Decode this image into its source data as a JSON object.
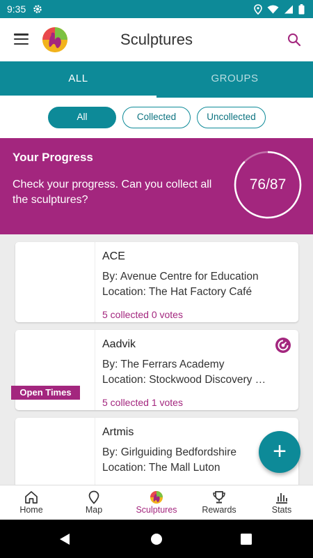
{
  "status_bar": {
    "time": "9:35"
  },
  "app_bar": {
    "title": "Sculptures"
  },
  "tabs": [
    {
      "label": "ALL",
      "active": true
    },
    {
      "label": "GROUPS",
      "active": false
    }
  ],
  "filters": [
    {
      "label": "All",
      "active": true
    },
    {
      "label": "Collected",
      "active": false
    },
    {
      "label": "Uncollected",
      "active": false
    }
  ],
  "progress": {
    "title": "Your Progress",
    "text": "Check your progress. Can you collect all the sculptures?",
    "count": "76/87",
    "collected": 76,
    "total": 87
  },
  "sculptures": [
    {
      "name": "ACE",
      "by": "By: Avenue Centre for Education",
      "location": "Location: The Hat Factory Café",
      "collected": "5 collected",
      "votes": "0 votes"
    },
    {
      "name": "Aadvik",
      "by": "By: The Ferrars Academy",
      "location": "Location: Stockwood Discovery …",
      "collected": "5 collected",
      "votes": "1 votes",
      "badge": "Open Times",
      "status_icon": "collected-icon"
    },
    {
      "name": "Artmis",
      "by": "By: Girlguiding Bedfordshire",
      "location": "Location: The Mall Luton",
      "collected": "",
      "votes": ""
    }
  ],
  "fab": {
    "label": "+"
  },
  "bottom_nav": [
    {
      "label": "Home",
      "icon": "home-icon"
    },
    {
      "label": "Map",
      "icon": "map-pin-icon"
    },
    {
      "label": "Sculptures",
      "icon": "sculptures-icon",
      "active": true
    },
    {
      "label": "Rewards",
      "icon": "trophy-icon"
    },
    {
      "label": "Stats",
      "icon": "stats-icon"
    }
  ],
  "colors": {
    "teal": "#0d8a98",
    "magenta": "#a3267e"
  }
}
